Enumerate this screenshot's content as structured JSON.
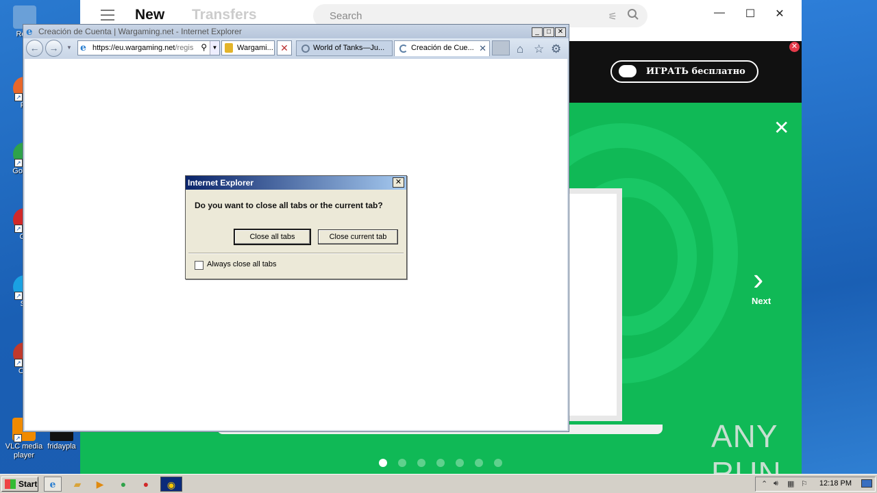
{
  "desktop": {
    "icons": [
      {
        "label": "Recy",
        "color": "#6aa0d8"
      },
      {
        "label": "Fir",
        "color": "#e8672a"
      },
      {
        "label": "Go Chr",
        "color": "#2fa24a"
      },
      {
        "label": "Op",
        "color": "#d12929"
      },
      {
        "label": "Sk",
        "color": "#1aa1e2"
      },
      {
        "label": "CCl",
        "color": "#c0392b"
      },
      {
        "label": "VLC media player",
        "color": "#f08a00"
      },
      {
        "label": "fridaypla",
        "color": "#111111"
      }
    ]
  },
  "bg_app": {
    "tab_new": "New",
    "tab_transfers": "Transfers",
    "search_placeholder": "Search",
    "play_button": "ИГРАТЬ бесплатно",
    "next_label": "Next",
    "watermark": "ANY RUN",
    "carousel_total": 7,
    "carousel_active": 1
  },
  "ie": {
    "title": "Creación de Cuenta | Wargaming.net - Internet Explorer",
    "address": "https://eu.wargaming.net/regis",
    "address_host": "https://eu.wargaming.net",
    "address_rest": "/regis",
    "security_label": "Wargami...",
    "tabs": [
      {
        "label": "World of Tanks—Ju..."
      },
      {
        "label": "Creación de Cue..."
      }
    ]
  },
  "dialog": {
    "title": "Internet Explorer",
    "question": "Do you want to close all tabs or the current tab?",
    "close_all": "Close all tabs",
    "close_current": "Close current tab",
    "always_label": "Always close all tabs",
    "always_checked": false
  },
  "taskbar": {
    "start": "Start",
    "clock": "12:18 PM"
  },
  "colors": {
    "accent_green": "#10b956",
    "banner_black": "#111111",
    "dialog_title_start": "#0a246a"
  }
}
